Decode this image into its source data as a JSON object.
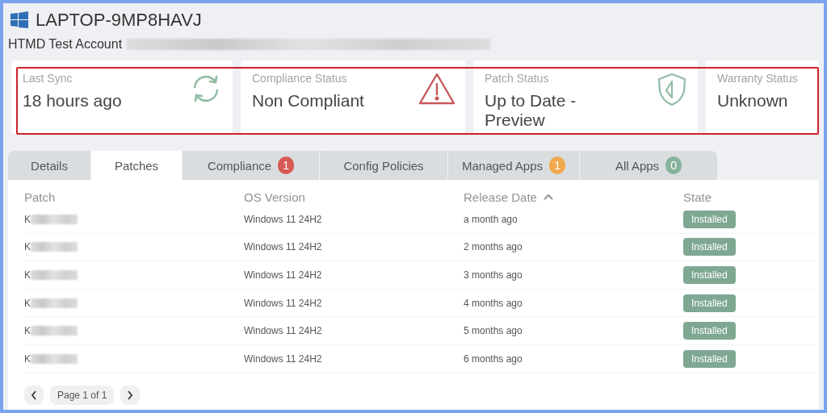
{
  "device": {
    "name": "LAPTOP-9MP8HAVJ",
    "account": "HTMD Test Account"
  },
  "cards": [
    {
      "label": "Last Sync",
      "value": "18 hours ago",
      "kind": "sync"
    },
    {
      "label": "Compliance Status",
      "value": "Non Compliant",
      "kind": "warning"
    },
    {
      "label": "Patch Status",
      "value": "Up to Date - Preview",
      "kind": "shield"
    },
    {
      "label": "Warranty Status",
      "value": "Unknown",
      "kind": "none"
    }
  ],
  "tabs": [
    {
      "label": "Details",
      "selected": false
    },
    {
      "label": "Patches",
      "selected": true
    },
    {
      "label": "Compliance",
      "selected": false,
      "badge": "1",
      "color": "#d65a55"
    },
    {
      "label": "Config Policies",
      "selected": false
    },
    {
      "label": "Managed Apps",
      "selected": false,
      "badge": "1",
      "color": "#f0a94f"
    },
    {
      "label": "All Apps",
      "selected": false,
      "badge": "0",
      "color": "#85b39c"
    }
  ],
  "table": {
    "columns": [
      {
        "label": "Patch",
        "sorted": false
      },
      {
        "label": "OS Version",
        "sorted": false
      },
      {
        "label": "Release Date",
        "sorted": true
      },
      {
        "label": "State",
        "sorted": false
      }
    ],
    "rows": [
      {
        "patch": "K",
        "os": "Windows 11 24H2",
        "released": "a month ago",
        "state": "Installed"
      },
      {
        "patch": "K",
        "os": "Windows 11 24H2",
        "released": "2 months ago",
        "state": "Installed"
      },
      {
        "patch": "K",
        "os": "Windows 11 24H2",
        "released": "3 months ago",
        "state": "Installed"
      },
      {
        "patch": "K",
        "os": "Windows 11 24H2",
        "released": "4 months ago",
        "state": "Installed"
      },
      {
        "patch": "K",
        "os": "Windows 11 24H2",
        "released": "5 months ago",
        "state": "Installed"
      },
      {
        "patch": "K",
        "os": "Windows 11 24H2",
        "released": "6 months ago",
        "state": "Installed"
      }
    ]
  },
  "pagination": {
    "page": "Page 1 of 1"
  }
}
